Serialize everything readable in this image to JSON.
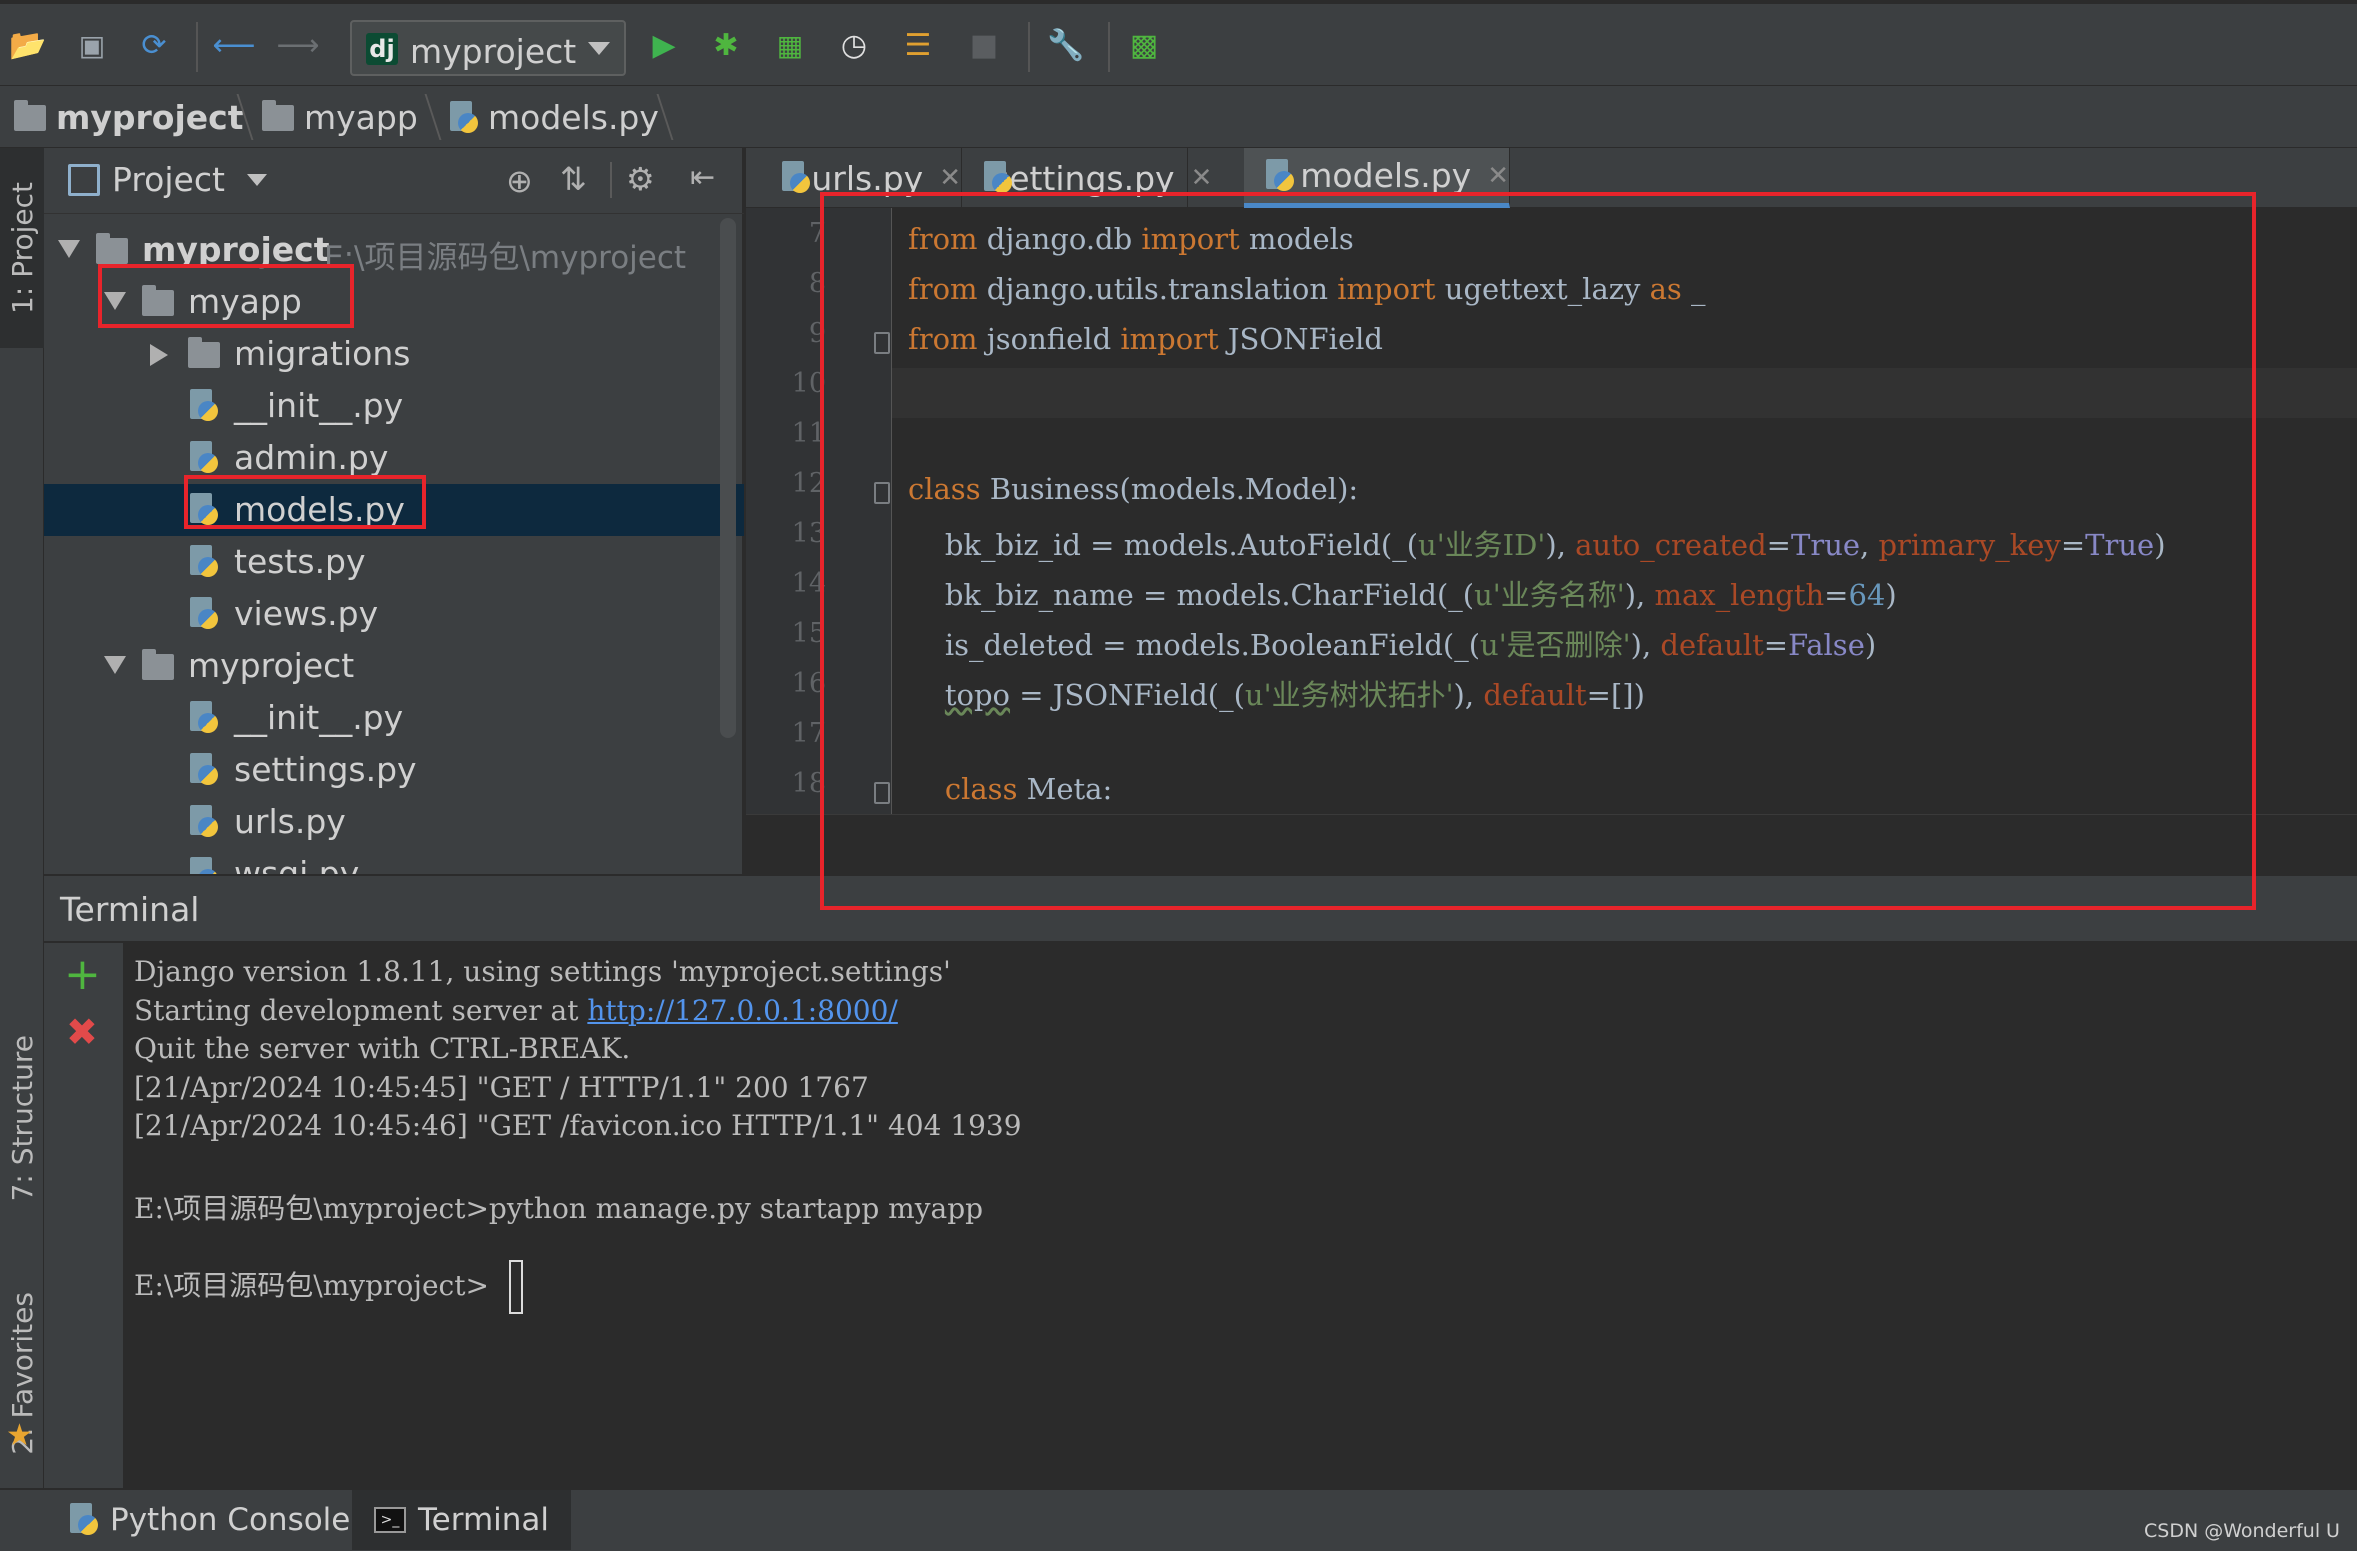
{
  "toolbar": {
    "run_config": "myproject",
    "run_config_badge": "dj",
    "buttons": [
      "open-folder-icon",
      "save-icon",
      "sync-icon",
      "back-icon",
      "forward-icon",
      "run-icon",
      "debug-icon",
      "coverage-icon",
      "profile-icon",
      "concurrency-icon",
      "stop-icon",
      "settings-wrench-icon",
      "sdk-manager-icon"
    ]
  },
  "breadcrumb": [
    "myproject",
    "myapp",
    "models.py"
  ],
  "left_strip": {
    "project_tab": "1: Project",
    "structure_tab": "7: Structure",
    "favorites_tab": "2: Favorites"
  },
  "project_panel": {
    "title": "Project",
    "tree": [
      {
        "name": "myproject",
        "path": "E:\\项目源码包\\myproject",
        "type": "folder",
        "depth": 0,
        "expanded": true,
        "bold": true
      },
      {
        "name": "myapp",
        "type": "folder",
        "depth": 1,
        "expanded": true
      },
      {
        "name": "migrations",
        "type": "folder",
        "depth": 2,
        "expanded": false
      },
      {
        "name": "__init__.py",
        "type": "py",
        "depth": 2
      },
      {
        "name": "admin.py",
        "type": "py",
        "depth": 2
      },
      {
        "name": "models.py",
        "type": "py",
        "depth": 2,
        "selected": true
      },
      {
        "name": "tests.py",
        "type": "py",
        "depth": 2
      },
      {
        "name": "views.py",
        "type": "py",
        "depth": 2
      },
      {
        "name": "myproject",
        "type": "folder",
        "depth": 1,
        "expanded": true
      },
      {
        "name": "__init__.py",
        "type": "py",
        "depth": 2
      },
      {
        "name": "settings.py",
        "type": "py",
        "depth": 2
      },
      {
        "name": "urls.py",
        "type": "py",
        "depth": 2
      },
      {
        "name": "wsgi.py",
        "type": "py",
        "depth": 2
      }
    ]
  },
  "editor": {
    "tabs": [
      {
        "label": "urls.py",
        "active": false
      },
      {
        "label": "settings.py",
        "active": false
      },
      {
        "label": "models.py",
        "active": true
      }
    ],
    "line_numbers": [
      "7",
      "8",
      "9",
      "10",
      "11",
      "12",
      "13",
      "14",
      "15",
      "16",
      "17",
      "18"
    ],
    "lines": [
      [
        {
          "t": "from",
          "c": "kw"
        },
        {
          "t": " django.db "
        },
        {
          "t": "import",
          "c": "kw"
        },
        {
          "t": " models"
        }
      ],
      [
        {
          "t": "from",
          "c": "kw"
        },
        {
          "t": " django.utils.translation "
        },
        {
          "t": "import",
          "c": "kw"
        },
        {
          "t": " ugettext_lazy "
        },
        {
          "t": "as",
          "c": "kw"
        },
        {
          "t": " _"
        }
      ],
      [
        {
          "t": "from",
          "c": "kw"
        },
        {
          "t": " jsonfield "
        },
        {
          "t": "import",
          "c": "kw"
        },
        {
          "t": " JSONField"
        }
      ],
      [],
      [],
      [
        {
          "t": "class",
          "c": "kw"
        },
        {
          "t": " Business(models.Model):"
        }
      ],
      [
        {
          "t": "    bk_biz_id = models.AutoField(_("
        },
        {
          "t": "u'业务ID'",
          "c": "st"
        },
        {
          "t": "), "
        },
        {
          "t": "auto_created",
          "c": "pm"
        },
        {
          "t": "="
        },
        {
          "t": "True",
          "c": "bl"
        },
        {
          "t": ", "
        },
        {
          "t": "primary_key",
          "c": "pm"
        },
        {
          "t": "="
        },
        {
          "t": "True",
          "c": "bl"
        },
        {
          "t": ")"
        }
      ],
      [
        {
          "t": "    bk_biz_name = models.CharField(_("
        },
        {
          "t": "u'业务名称'",
          "c": "st"
        },
        {
          "t": "), "
        },
        {
          "t": "max_length",
          "c": "pm"
        },
        {
          "t": "="
        },
        {
          "t": "64",
          "c": "nm"
        },
        {
          "t": ")"
        }
      ],
      [
        {
          "t": "    is_deleted = models.BooleanField(_("
        },
        {
          "t": "u'是否删除'",
          "c": "st"
        },
        {
          "t": "), "
        },
        {
          "t": "default",
          "c": "pm"
        },
        {
          "t": "="
        },
        {
          "t": "False",
          "c": "bl"
        },
        {
          "t": ")"
        }
      ],
      [
        {
          "t": "    "
        },
        {
          "t": "topo",
          "c": "wv"
        },
        {
          "t": " = JSONField(_("
        },
        {
          "t": "u'业务树状拓扑'",
          "c": "st"
        },
        {
          "t": "), "
        },
        {
          "t": "default",
          "c": "pm"
        },
        {
          "t": "=[])"
        }
      ],
      [],
      [
        {
          "t": "    "
        },
        {
          "t": "class",
          "c": "kw"
        },
        {
          "t": " Meta:"
        }
      ]
    ]
  },
  "terminal": {
    "title": "Terminal",
    "lines": [
      {
        "text": "Django version 1.8.11, using settings 'myproject.settings'"
      },
      {
        "text": "Starting development server at ",
        "link": "http://127.0.0.1:8000/"
      },
      {
        "text": "Quit the server with CTRL-BREAK."
      },
      {
        "text": "[21/Apr/2024 10:45:45] \"GET / HTTP/1.1\" 200 1767"
      },
      {
        "text": "[21/Apr/2024 10:45:46] \"GET /favicon.ico HTTP/1.1\" 404 1939"
      },
      {
        "text": ""
      },
      {
        "text": "E:\\项目源码包\\myproject>python manage.py startapp myapp"
      },
      {
        "text": ""
      },
      {
        "text": "E:\\项目源码包\\myproject>"
      }
    ]
  },
  "bottom_tabs": [
    {
      "label": "Python Console",
      "active": false
    },
    {
      "label": "Terminal",
      "active": true
    }
  ],
  "watermark": "CSDN @Wonderful",
  "status_right": "U",
  "colors": {
    "highlight_box": "#e8242b",
    "keyword": "#cc7832",
    "string": "#6a8759",
    "param": "#aa4926",
    "builtin": "#8888c6",
    "number": "#6897bb",
    "link": "#5394ec"
  }
}
